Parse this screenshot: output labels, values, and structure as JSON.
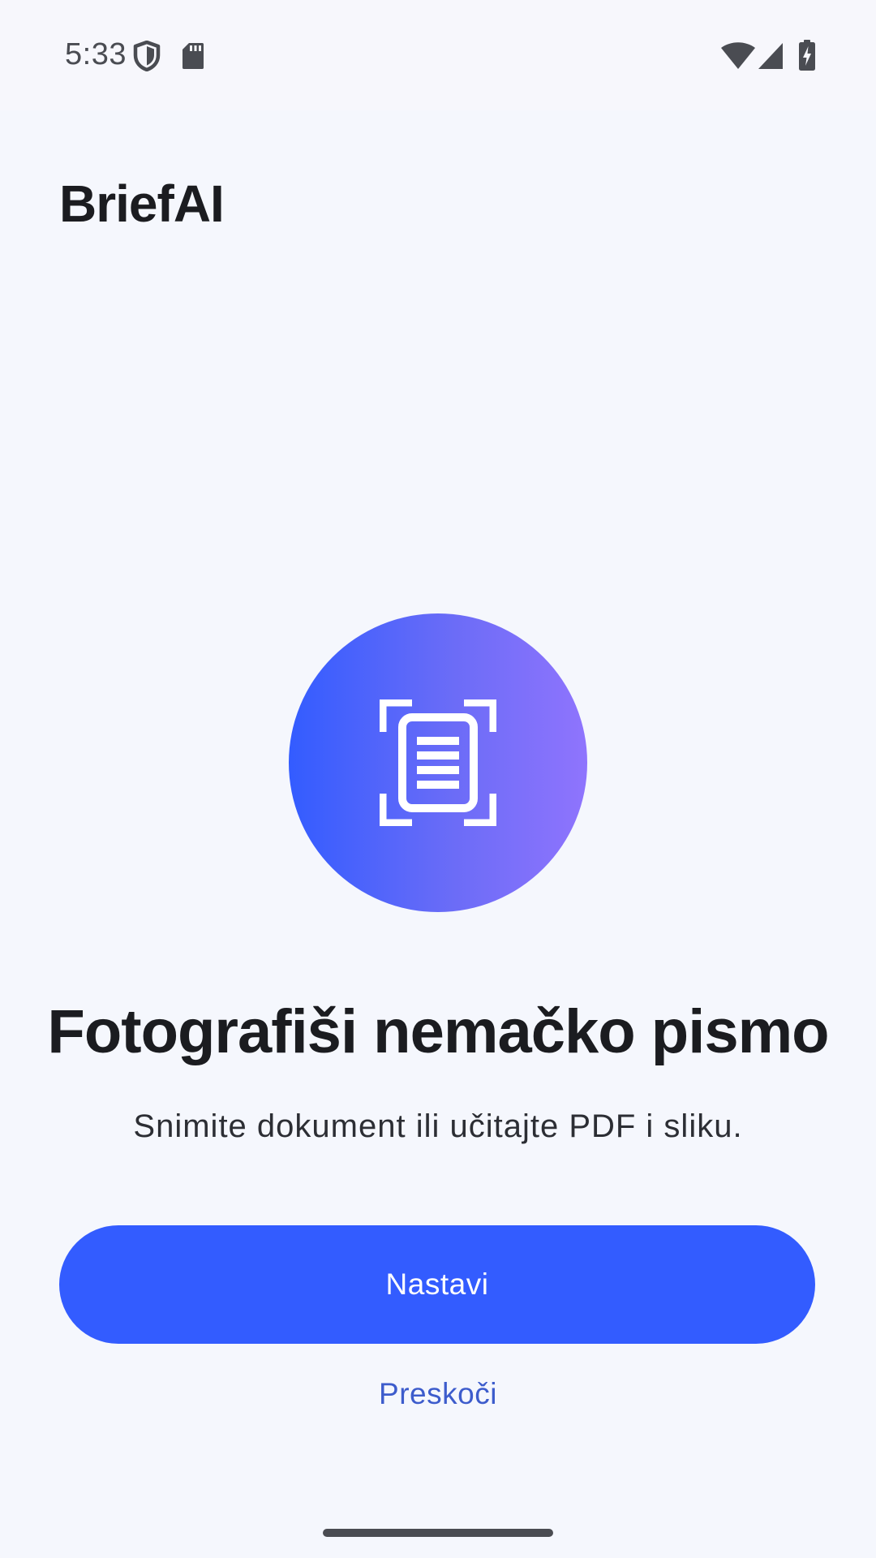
{
  "status_bar": {
    "time": "5:33",
    "icons": [
      "shield-icon",
      "sd-card-icon",
      "wifi-icon",
      "signal-icon",
      "battery-charging-icon"
    ]
  },
  "header": {
    "title": "BriefAI"
  },
  "hero": {
    "icon": "document-scan-icon",
    "gradient_start": "#335cff",
    "gradient_end": "#8f74fd"
  },
  "content": {
    "headline": "Fotografiši nemačko pismo",
    "subtitle": "Snimite dokument ili učitajte PDF i sliku."
  },
  "actions": {
    "primary_label": "Nastavi",
    "skip_label": "Preskoči",
    "primary_color": "#335cff",
    "link_color": "#3d5ccc"
  }
}
